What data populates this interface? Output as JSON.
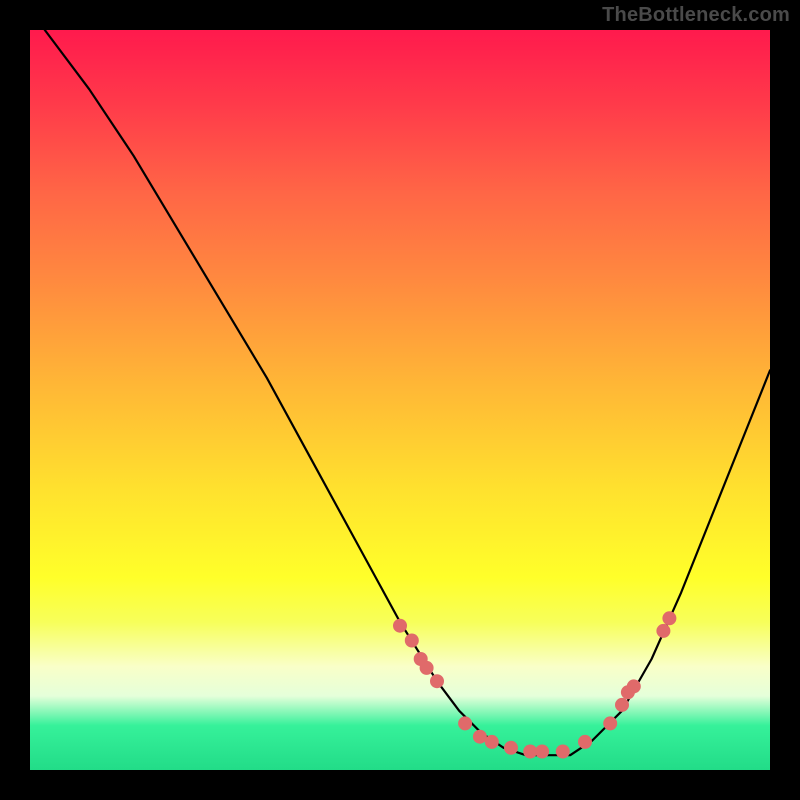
{
  "watermark": "TheBottleneck.com",
  "chart_data": {
    "type": "line",
    "title": "",
    "xlabel": "",
    "ylabel": "",
    "xlim": [
      0,
      100
    ],
    "ylim": [
      0,
      100
    ],
    "grid": false,
    "legend": false,
    "series": [
      {
        "name": "curve",
        "x": [
          2,
          8,
          14,
          20,
          26,
          32,
          38,
          44,
          50,
          55,
          58,
          61,
          64,
          67,
          70,
          73,
          76,
          80,
          84,
          88,
          92,
          96,
          100
        ],
        "y": [
          100,
          92,
          83,
          73,
          63,
          53,
          42,
          31,
          20,
          12,
          8,
          5,
          3,
          2,
          2,
          2,
          4,
          8,
          15,
          24,
          34,
          44,
          54
        ]
      },
      {
        "name": "markers",
        "style": "scatter",
        "x": [
          50.0,
          51.6,
          52.8,
          53.6,
          55.0,
          58.8,
          60.8,
          62.4,
          65.0,
          67.6,
          69.2,
          72.0,
          75.0,
          78.4,
          80.0,
          80.8,
          81.6,
          85.6,
          86.4
        ],
        "y": [
          19.5,
          17.5,
          15.0,
          13.8,
          12.0,
          6.3,
          4.5,
          3.8,
          3.0,
          2.5,
          2.5,
          2.5,
          3.8,
          6.3,
          8.8,
          10.5,
          11.3,
          18.8,
          20.5
        ]
      }
    ]
  }
}
